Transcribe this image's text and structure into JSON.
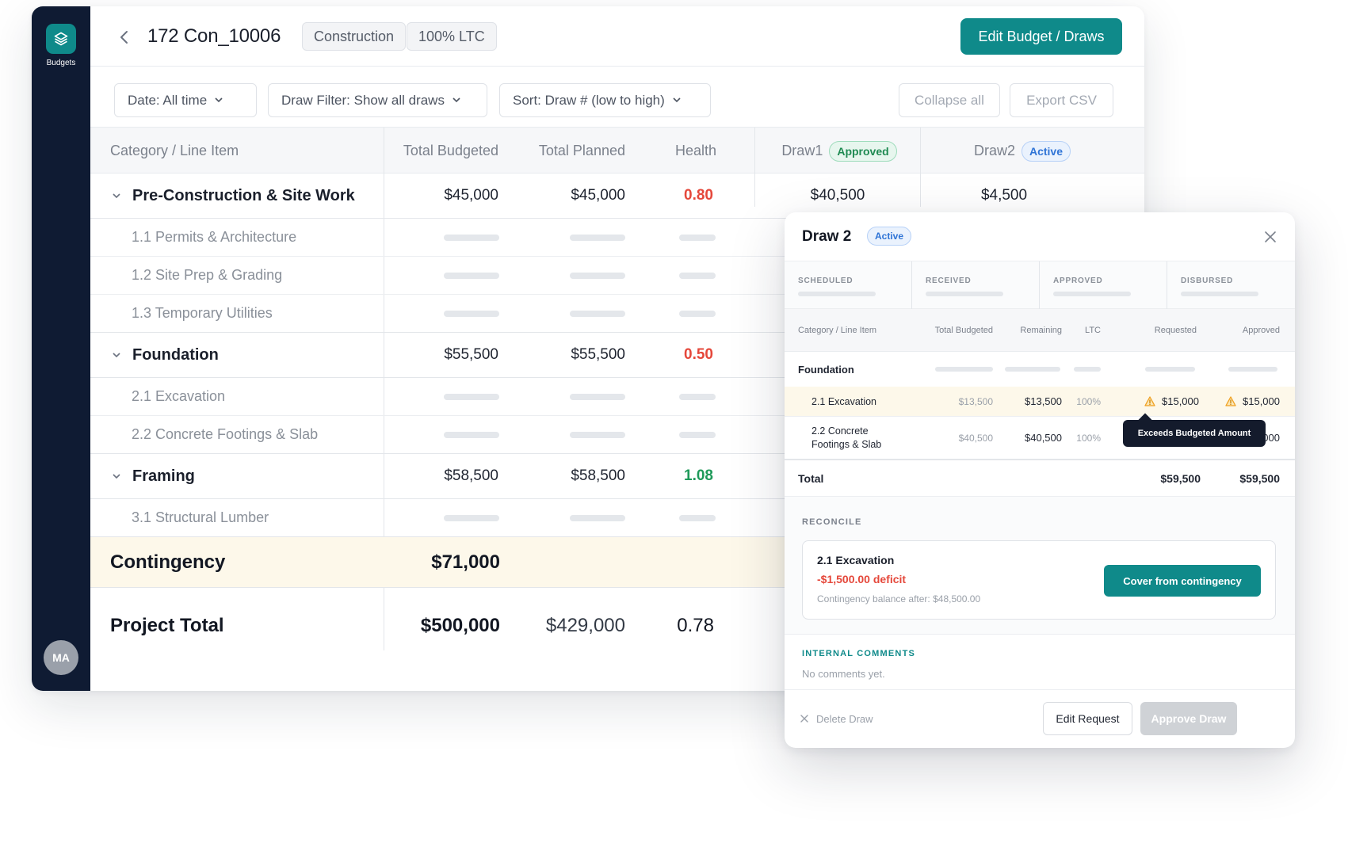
{
  "sidebar": {
    "nav_label": "Budgets",
    "avatar_initials": "MA"
  },
  "header": {
    "title": "172 Con_10006",
    "tags": [
      "Construction",
      "100% LTC"
    ],
    "primary_action": "Edit Budget / Draws"
  },
  "filters": {
    "date": "Date: All time",
    "draw_filter": "Draw Filter: Show all draws",
    "sort": "Sort: Draw # (low to high)",
    "collapse": "Collapse all",
    "export": "Export CSV"
  },
  "table": {
    "columns": {
      "category": "Category / Line Item",
      "total_budgeted": "Total Budgeted",
      "total_planned": "Total Planned",
      "health": "Health",
      "draw1": "Draw1",
      "draw1_status": "Approved",
      "draw2": "Draw2",
      "draw2_status": "Active"
    },
    "categories": [
      {
        "name": "Pre-Construction & Site Work",
        "budgeted": "$45,000",
        "planned": "$45,000",
        "health": "0.80",
        "draw1": "$40,500",
        "draw2": "$4,500",
        "items": [
          "1.1 Permits & Architecture",
          "1.2 Site Prep & Grading",
          "1.3 Temporary Utilities"
        ]
      },
      {
        "name": "Foundation",
        "budgeted": "$55,500",
        "planned": "$55,500",
        "health": "0.50",
        "items": [
          "2.1 Excavation",
          "2.2 Concrete Footings & Slab"
        ]
      },
      {
        "name": "Framing",
        "budgeted": "$58,500",
        "planned": "$58,500",
        "health": "1.08",
        "items": [
          "3.1 Structural Lumber"
        ]
      }
    ],
    "contingency": {
      "label": "Contingency",
      "budgeted": "$71,000"
    },
    "project_total": {
      "label": "Project Total",
      "budgeted": "$500,000",
      "planned": "$429,000",
      "health": "0.78"
    }
  },
  "draw_panel": {
    "title": "Draw 2",
    "status": "Active",
    "stages": [
      "SCHEDULED",
      "RECEIVED",
      "APPROVED",
      "DISBURSED"
    ],
    "columns": {
      "category": "Category / Line Item",
      "total_budgeted": "Total Budgeted",
      "remaining": "Remaining",
      "ltc": "LTC",
      "requested": "Requested",
      "approved": "Approved"
    },
    "group": "Foundation",
    "rows": [
      {
        "name": "2.1 Excavation",
        "budgeted": "$13,500",
        "remaining": "$13,500",
        "ltc": "100%",
        "requested": "$15,000",
        "approved": "$15,000"
      },
      {
        "name_line1": "2.2 Concrete",
        "name_line2": "Footings & Slab",
        "budgeted": "$40,500",
        "remaining": "$40,500",
        "ltc": "100%",
        "approved_partial": "000"
      }
    ],
    "tooltip": "Exceeds Budgeted Amount",
    "total": {
      "label": "Total",
      "requested": "$59,500",
      "approved": "$59,500"
    },
    "reconcile": {
      "label": "RECONCILE",
      "item": "2.1 Excavation",
      "deficit": "-$1,500.00 deficit",
      "balance_after": "Contingency balance after: $48,500.00",
      "action": "Cover from contingency"
    },
    "comments": {
      "label": "INTERNAL COMMENTS",
      "empty": "No comments yet."
    },
    "footer": {
      "delete": "Delete Draw",
      "edit": "Edit Request",
      "approve": "Approve Draw"
    }
  },
  "colors": {
    "sidebar": "#0f1b33",
    "accent": "#0f8a8a",
    "danger": "#e5483b",
    "success": "#1f9a5a",
    "warning": "#f0a020",
    "contingency_bg": "#fdf8ea"
  }
}
